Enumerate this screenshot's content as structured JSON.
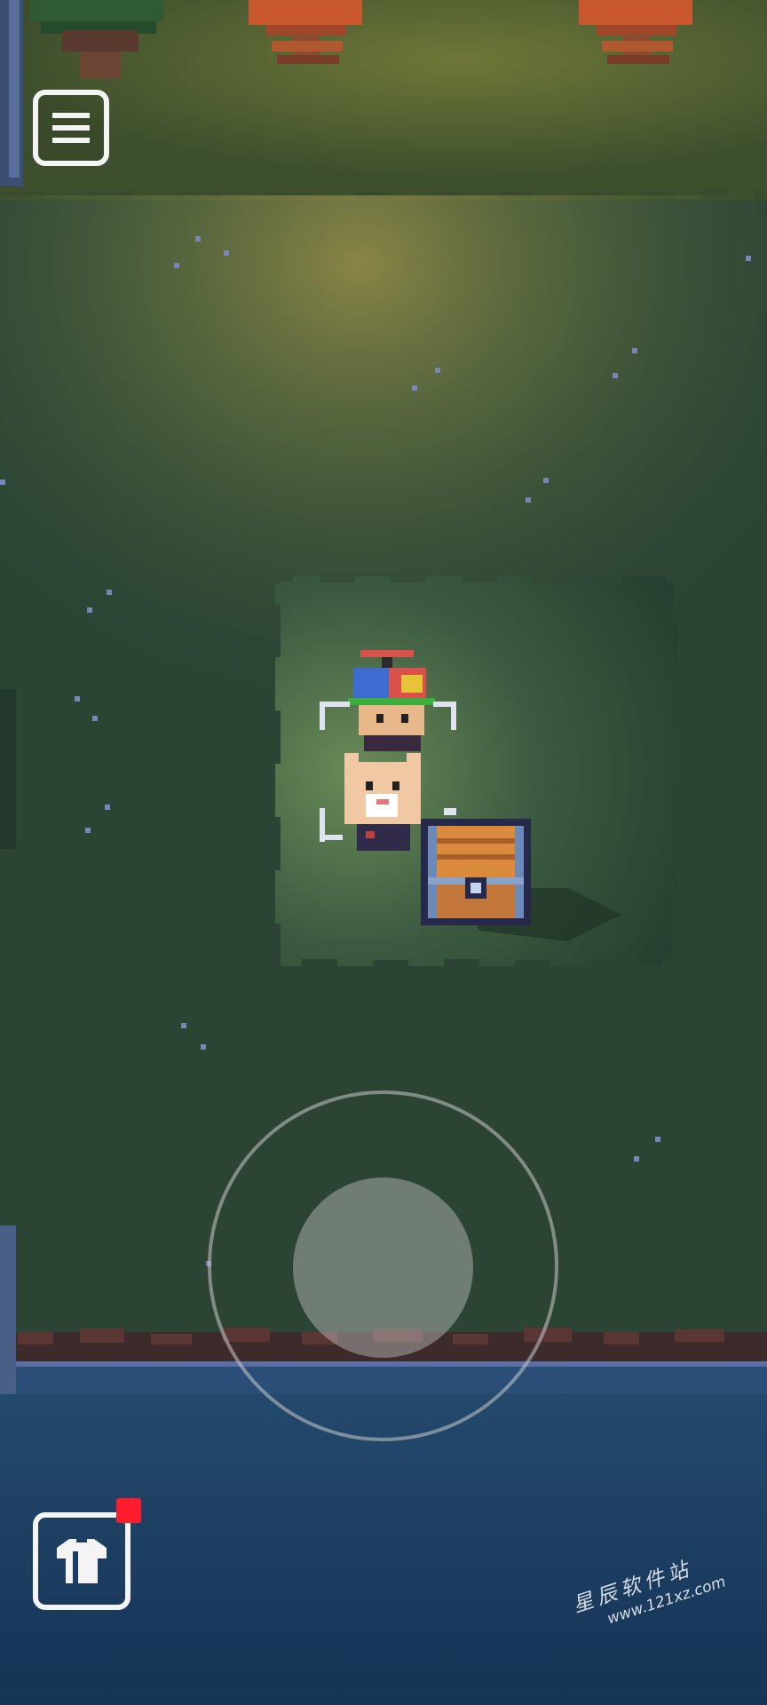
{
  "hud": {
    "menu_button": {
      "icon": "hamburger-menu-icon"
    },
    "wardrobe_button": {
      "icon": "shirt-icon",
      "has_notification": true,
      "notification_color": "#ff1d2c"
    },
    "joystick": {
      "icon": "virtual-joystick"
    }
  },
  "scene": {
    "characters": [
      "propeller-cap-kid",
      "cat-companion"
    ],
    "objects": [
      "treasure-chest",
      "scarecrow-left",
      "scarecrow-right",
      "tree-top-left"
    ]
  },
  "colors": {
    "grass": "#2c4535",
    "grass_lit": "#5c7d4f",
    "water": "#1b3c64",
    "hud_white": "#f4f4f4"
  },
  "watermark": {
    "cn_text": "星辰软件站",
    "url_text": "www.121xz.com"
  }
}
